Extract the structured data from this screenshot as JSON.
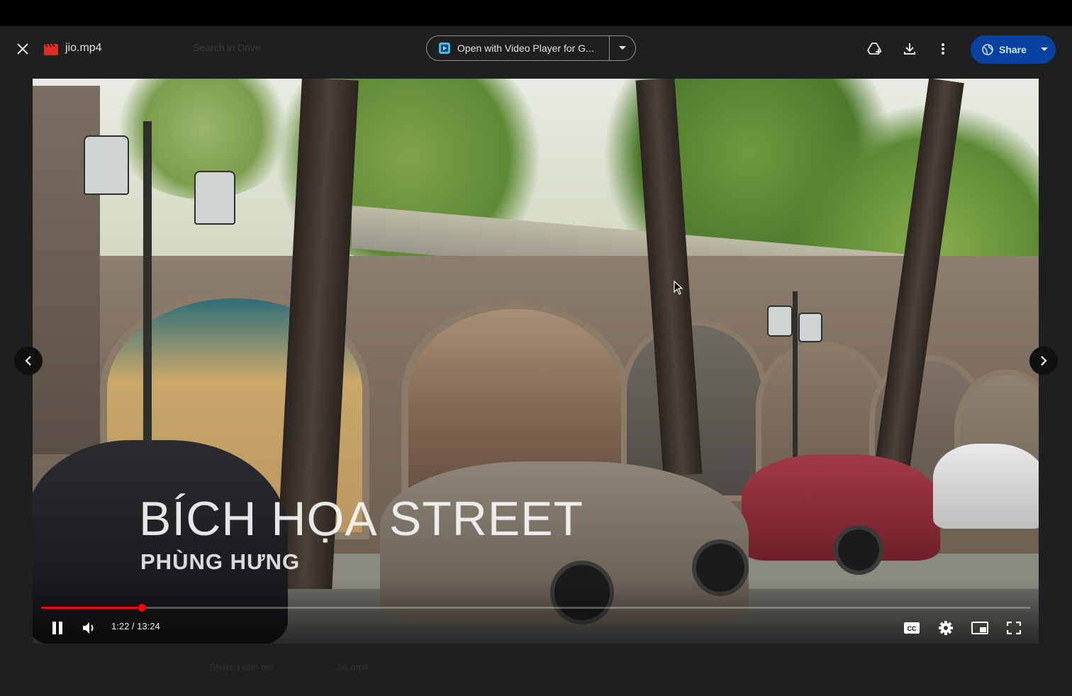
{
  "header": {
    "file_name": "jio.mp4",
    "search_placeholder": "Search in Drive",
    "open_with_label": "Open with Video Player for G...",
    "share_label": "Share"
  },
  "video": {
    "title_text": "BÍCH HỌA STREET",
    "subtitle_text": "PHÙNG HƯNG",
    "time_display": "1:22 / 13:24",
    "progress_fraction": 0.1021
  },
  "footer": {
    "ghost_left": "Shared with me",
    "ghost_right": "Jio.mp4"
  },
  "icons": {
    "close": "close-icon",
    "file": "video-file-icon",
    "add_to_drive": "add-to-drive-icon",
    "download": "download-icon",
    "more": "more-vertical-icon",
    "share": "globe-icon",
    "play_pause": "pause-icon",
    "volume": "volume-icon",
    "captions": "cc-icon",
    "settings": "settings-gear-icon",
    "miniplayer": "miniplayer-icon",
    "fullscreen": "fullscreen-icon",
    "prev": "chevron-left-icon",
    "next": "chevron-right-icon"
  },
  "colors": {
    "background": "#1e1f20",
    "share_button": "#0842a0",
    "progress": "#ff0000",
    "file_icon": "#d93025"
  }
}
